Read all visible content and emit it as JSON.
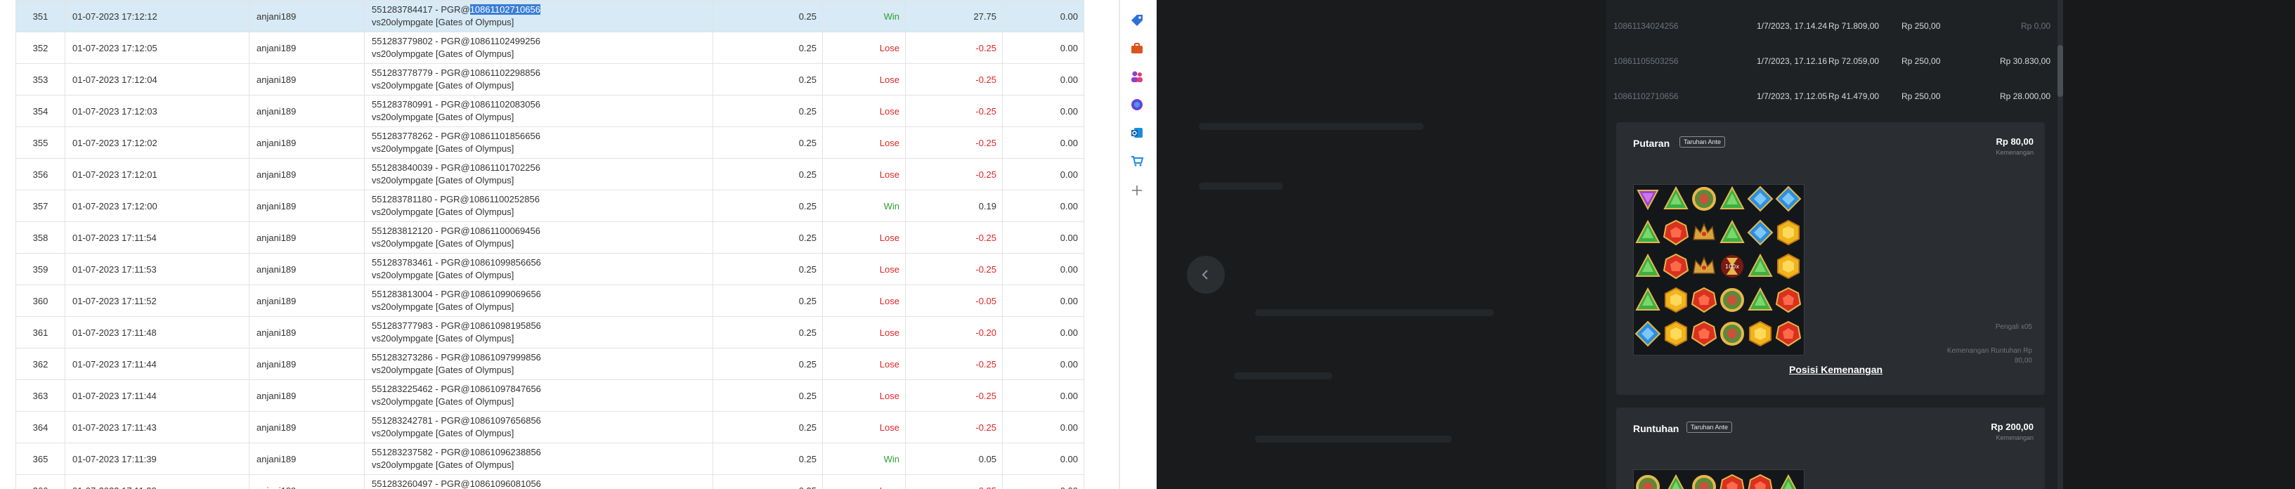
{
  "table": {
    "rows": [
      {
        "no": "351",
        "datetime": "01-07-2023 17:12:12",
        "user": "anjani189",
        "txn_prefix": "551283784417 - PGR@",
        "txn_id": "10861102710656",
        "game": "vs20olympgate [Gates of Olympus]",
        "bet": "0.25",
        "result": "Win",
        "winloss": "27.75",
        "extra": "0.00",
        "highlight": true
      },
      {
        "no": "352",
        "datetime": "01-07-2023 17:12:05",
        "user": "anjani189",
        "txn_prefix": "551283779802 - PGR@",
        "txn_id": "10861102499256",
        "game": "vs20olympgate [Gates of Olympus]",
        "bet": "0.25",
        "result": "Lose",
        "winloss": "-0.25",
        "extra": "0.00"
      },
      {
        "no": "353",
        "datetime": "01-07-2023 17:12:04",
        "user": "anjani189",
        "txn_prefix": "551283778779 - PGR@",
        "txn_id": "10861102298856",
        "game": "vs20olympgate [Gates of Olympus]",
        "bet": "0.25",
        "result": "Lose",
        "winloss": "-0.25",
        "extra": "0.00"
      },
      {
        "no": "354",
        "datetime": "01-07-2023 17:12:03",
        "user": "anjani189",
        "txn_prefix": "551283780991 - PGR@",
        "txn_id": "10861102083056",
        "game": "vs20olympgate [Gates of Olympus]",
        "bet": "0.25",
        "result": "Lose",
        "winloss": "-0.25",
        "extra": "0.00"
      },
      {
        "no": "355",
        "datetime": "01-07-2023 17:12:02",
        "user": "anjani189",
        "txn_prefix": "551283778262 - PGR@",
        "txn_id": "10861101856656",
        "game": "vs20olympgate [Gates of Olympus]",
        "bet": "0.25",
        "result": "Lose",
        "winloss": "-0.25",
        "extra": "0.00"
      },
      {
        "no": "356",
        "datetime": "01-07-2023 17:12:01",
        "user": "anjani189",
        "txn_prefix": "551283840039 - PGR@",
        "txn_id": "10861101702256",
        "game": "vs20olympgate [Gates of Olympus]",
        "bet": "0.25",
        "result": "Lose",
        "winloss": "-0.25",
        "extra": "0.00"
      },
      {
        "no": "357",
        "datetime": "01-07-2023 17:12:00",
        "user": "anjani189",
        "txn_prefix": "551283781180 - PGR@",
        "txn_id": "10861100252856",
        "game": "vs20olympgate [Gates of Olympus]",
        "bet": "0.25",
        "result": "Win",
        "winloss": "0.19",
        "extra": "0.00"
      },
      {
        "no": "358",
        "datetime": "01-07-2023 17:11:54",
        "user": "anjani189",
        "txn_prefix": "551283812120 - PGR@",
        "txn_id": "10861100069456",
        "game": "vs20olympgate [Gates of Olympus]",
        "bet": "0.25",
        "result": "Lose",
        "winloss": "-0.25",
        "extra": "0.00"
      },
      {
        "no": "359",
        "datetime": "01-07-2023 17:11:53",
        "user": "anjani189",
        "txn_prefix": "551283783461 - PGR@",
        "txn_id": "10861099856656",
        "game": "vs20olympgate [Gates of Olympus]",
        "bet": "0.25",
        "result": "Lose",
        "winloss": "-0.25",
        "extra": "0.00"
      },
      {
        "no": "360",
        "datetime": "01-07-2023 17:11:52",
        "user": "anjani189",
        "txn_prefix": "551283813004 - PGR@",
        "txn_id": "10861099069656",
        "game": "vs20olympgate [Gates of Olympus]",
        "bet": "0.25",
        "result": "Lose",
        "winloss": "-0.05",
        "extra": "0.00"
      },
      {
        "no": "361",
        "datetime": "01-07-2023 17:11:48",
        "user": "anjani189",
        "txn_prefix": "551283777983 - PGR@",
        "txn_id": "10861098195856",
        "game": "vs20olympgate [Gates of Olympus]",
        "bet": "0.25",
        "result": "Lose",
        "winloss": "-0.20",
        "extra": "0.00"
      },
      {
        "no": "362",
        "datetime": "01-07-2023 17:11:44",
        "user": "anjani189",
        "txn_prefix": "551283273286 - PGR@",
        "txn_id": "10861097999856",
        "game": "vs20olympgate [Gates of Olympus]",
        "bet": "0.25",
        "result": "Lose",
        "winloss": "-0.25",
        "extra": "0.00"
      },
      {
        "no": "363",
        "datetime": "01-07-2023 17:11:44",
        "user": "anjani189",
        "txn_prefix": "551283225462 - PGR@",
        "txn_id": "10861097847656",
        "game": "vs20olympgate [Gates of Olympus]",
        "bet": "0.25",
        "result": "Lose",
        "winloss": "-0.25",
        "extra": "0.00"
      },
      {
        "no": "364",
        "datetime": "01-07-2023 17:11:43",
        "user": "anjani189",
        "txn_prefix": "551283242781 - PGR@",
        "txn_id": "10861097656856",
        "game": "vs20olympgate [Gates of Olympus]",
        "bet": "0.25",
        "result": "Lose",
        "winloss": "-0.25",
        "extra": "0.00"
      },
      {
        "no": "365",
        "datetime": "01-07-2023 17:11:39",
        "user": "anjani189",
        "txn_prefix": "551283237582 - PGR@",
        "txn_id": "10861096238856",
        "game": "vs20olympgate [Gates of Olympus]",
        "bet": "0.25",
        "result": "Win",
        "winloss": "0.05",
        "extra": "0.00"
      },
      {
        "no": "366",
        "datetime": "01-07-2023 17:11:38",
        "user": "anjani189",
        "txn_prefix": "551283260497 - PGR@",
        "txn_id": "10861096081056",
        "game": "vs20olympgate [Gates of Olympus]",
        "bet": "0.25",
        "result": "Lose",
        "winloss": "-0.25",
        "extra": "0.00"
      }
    ]
  },
  "sidebar_icons": [
    "tag-icon",
    "briefcase-icon",
    "people-icon",
    "puzzle-icon",
    "outlook-icon",
    "shopping-cart-icon",
    "add-icon"
  ],
  "history": {
    "rows": [
      {
        "id": "10861134024256",
        "date": "1/7/2023, 17.14.24",
        "balance": "Rp 71.809,00",
        "bet": "Rp 250,00",
        "win": "Rp 0,00"
      },
      {
        "id": "10861105503256",
        "date": "1/7/2023, 17.12.16",
        "balance": "Rp 72.059,00",
        "bet": "Rp 250,00",
        "win": "Rp 30.830,00"
      },
      {
        "id": "10861102710656",
        "date": "1/7/2023, 17.12.05",
        "balance": "Rp 41.479,00",
        "bet": "Rp 250,00",
        "win": "Rp 28.000,00"
      }
    ]
  },
  "spin_card": {
    "title": "Putaran",
    "badge": "Taruhan Ante",
    "amount": "Rp 80,00",
    "amount_label": "Kemenangan",
    "multiplier_note": "Pengali x05",
    "cascade_note_1": "Kemenangan Runtuhan Rp",
    "cascade_note_2": "80,00",
    "link": "Posisi Kemenangan"
  },
  "cascade_card": {
    "title": "Runtuhan",
    "badge": "Taruhan Ante",
    "amount": "Rp 200,00",
    "amount_label": "Kemenangan"
  },
  "grid": [
    [
      "purple",
      "green",
      "ring",
      "green",
      "blue",
      "blue"
    ],
    [
      "green",
      "red",
      "crown",
      "green",
      "blue",
      "yellow"
    ],
    [
      "green",
      "red",
      "crown",
      "hourglass",
      "green",
      "yellow"
    ],
    [
      "green",
      "yellow",
      "red",
      "ring",
      "green",
      "red"
    ],
    [
      "blue",
      "yellow",
      "red",
      "ring",
      "yellow",
      "red"
    ]
  ],
  "grid_peek": [
    "ring",
    "green",
    "ring",
    "red",
    "red",
    "green"
  ],
  "colors": {
    "win": "#2e9e2e",
    "lose": "#e02424",
    "highlight": "#d7eaf5",
    "selection": "#3b7dd8",
    "panel": "#1f2225",
    "card": "#2a2d31"
  }
}
